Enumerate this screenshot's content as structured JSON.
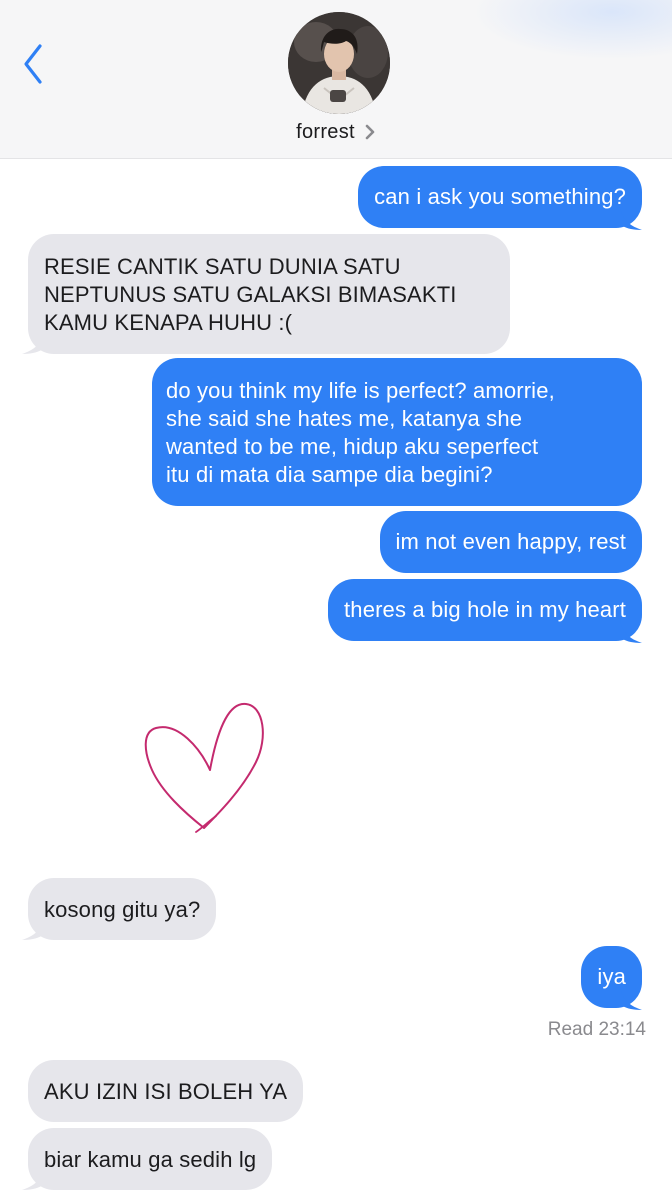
{
  "header": {
    "contact_name": "forrest"
  },
  "messages": [
    {
      "dir": "sent",
      "lines": [
        "can i ask you something?"
      ]
    },
    {
      "dir": "recv",
      "lines": [
        "RESIE CANTIK SATU DUNIA SATU",
        "NEPTUNUS SATU GALAKSI BIMASAKTI",
        "KAMU KENAPA HUHU :("
      ]
    },
    {
      "dir": "sent",
      "lines": [
        "do you think my life is perfect? amorrie,",
        "she said she hates me, katanya she",
        "wanted to be me, hidup aku seperfect",
        "itu di mata dia sampe dia begini?"
      ]
    },
    {
      "dir": "sent",
      "lines": [
        "im not even happy, rest"
      ]
    },
    {
      "dir": "sent",
      "lines": [
        "theres a big hole in my heart"
      ]
    },
    {
      "dir": "recv",
      "lines": [
        "kosong gitu ya?"
      ]
    },
    {
      "dir": "sent",
      "lines": [
        "iya"
      ]
    },
    {
      "dir": "recv",
      "lines": [
        "AKU IZIN ISI BOLEH YA"
      ]
    },
    {
      "dir": "recv",
      "lines": [
        "biar kamu ga sedih lg"
      ]
    }
  ],
  "receipt": {
    "label": "Read",
    "time": "23:14"
  },
  "colors": {
    "sent_bubble": "#2f80f5",
    "recv_bubble": "#e6e6eb",
    "heart_stroke": "#c42a6e",
    "accent": "#2f80f5"
  },
  "icons": {
    "back": "chevron-left-icon",
    "contact_details": "chevron-right-icon",
    "sticker": "heart-icon"
  }
}
